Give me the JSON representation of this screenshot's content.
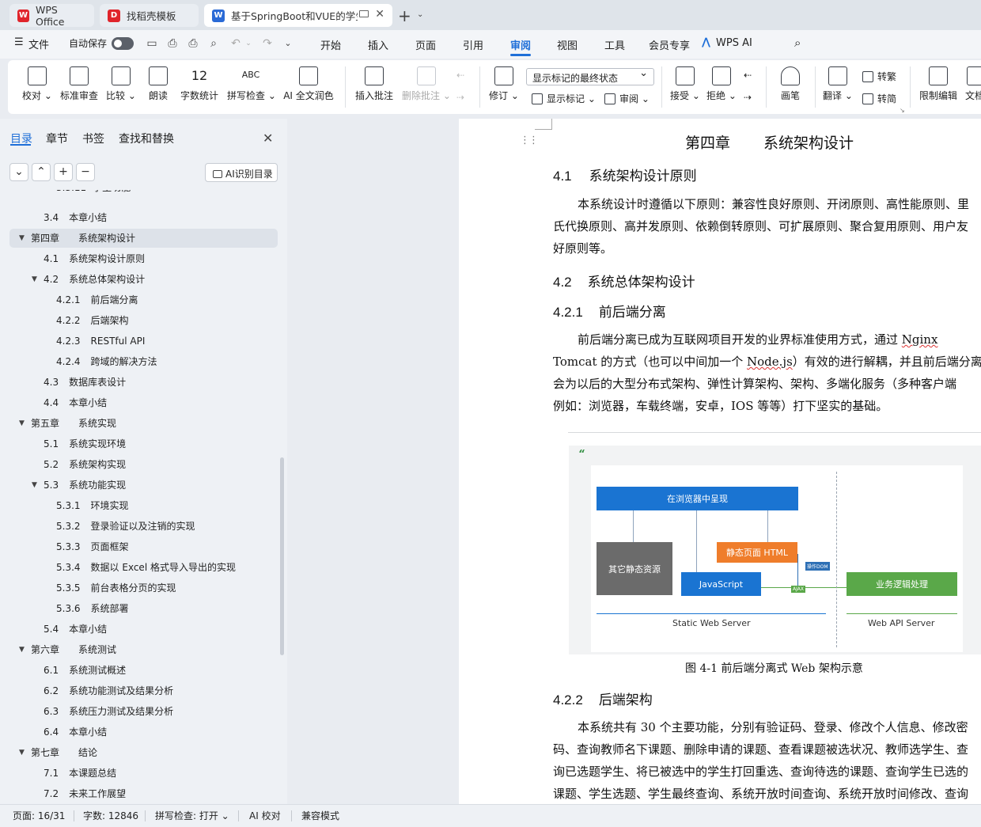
{
  "tabs": [
    {
      "label": "WPS Office",
      "icon": "wps-logo-icon",
      "color": "#e0242b"
    },
    {
      "label": "找稻壳模板",
      "icon": "docer-logo-icon",
      "color": "#e0242b"
    },
    {
      "label": "基于SpringBoot和VUE的学生",
      "icon": "word-doc-icon",
      "color": "#2a6ad6"
    }
  ],
  "menu": {
    "file": "文件",
    "autosave": "自动保存",
    "items": [
      "开始",
      "插入",
      "页面",
      "引用",
      "审阅",
      "视图",
      "工具",
      "会员专享"
    ],
    "active": "审阅",
    "wps_ai": "WPS AI"
  },
  "ribbon": {
    "proofread": "校对",
    "standard_review": "标准审查",
    "compare": "比较",
    "read_aloud": "朗读",
    "word_count": "字数统计",
    "spell_check": "拼写检查",
    "ai_polish": "AI 全文润色",
    "insert_comment": "插入批注",
    "delete_comment": "删除批注",
    "revise": "修订",
    "markup_select": "显示标记的最终状态",
    "show_markup": "显示标记",
    "review": "审阅",
    "accept": "接受",
    "reject": "拒绝",
    "brush": "画笔",
    "translate": "翻译",
    "to_trad": "转繁",
    "to_simp": "转简",
    "restrict_edit": "限制编辑",
    "doc_cut": "文档",
    "abc": "ABC",
    "count_icon_text": "12"
  },
  "sidebar": {
    "tabs": [
      "目录",
      "章节",
      "书签",
      "查找和替换"
    ],
    "ai_toc": "AI识别目录",
    "toc": [
      {
        "num": "3.3.11",
        "title": "学生功能",
        "level": 3,
        "partial": true
      },
      {
        "num": "3.4",
        "title": "本章小结",
        "level": 2
      },
      {
        "num": "第四章",
        "title": "系统架构设计",
        "level": 1,
        "expanded": true,
        "selected": true
      },
      {
        "num": "4.1",
        "title": "系统架构设计原则",
        "level": 2
      },
      {
        "num": "4.2",
        "title": "系统总体架构设计",
        "level": 2,
        "expanded": true
      },
      {
        "num": "4.2.1",
        "title": "前后端分离",
        "level": 3
      },
      {
        "num": "4.2.2",
        "title": "后端架构",
        "level": 3
      },
      {
        "num": "4.2.3",
        "title": "RESTful API",
        "level": 3
      },
      {
        "num": "4.2.4",
        "title": "跨域的解决方法",
        "level": 3
      },
      {
        "num": "4.3",
        "title": "数据库表设计",
        "level": 2
      },
      {
        "num": "4.4",
        "title": "本章小结",
        "level": 2
      },
      {
        "num": "第五章",
        "title": "系统实现",
        "level": 1,
        "expanded": true
      },
      {
        "num": "5.1",
        "title": "系统实现环境",
        "level": 2
      },
      {
        "num": "5.2",
        "title": "系统架构实现",
        "level": 2
      },
      {
        "num": "5.3",
        "title": "系统功能实现",
        "level": 2,
        "expanded": true
      },
      {
        "num": "5.3.1",
        "title": "环境实现",
        "level": 3
      },
      {
        "num": "5.3.2",
        "title": "登录验证以及注销的实现",
        "level": 3
      },
      {
        "num": "5.3.3",
        "title": "页面框架",
        "level": 3
      },
      {
        "num": "5.3.4",
        "title": "数据以 Excel 格式导入导出的实现",
        "level": 3
      },
      {
        "num": "5.3.5",
        "title": "前台表格分页的实现",
        "level": 3
      },
      {
        "num": "5.3.6",
        "title": "系统部署",
        "level": 3
      },
      {
        "num": "5.4",
        "title": "本章小结",
        "level": 2
      },
      {
        "num": "第六章",
        "title": "系统测试",
        "level": 1,
        "expanded": true
      },
      {
        "num": "6.1",
        "title": "系统测试概述",
        "level": 2
      },
      {
        "num": "6.2",
        "title": "系统功能测试及结果分析",
        "level": 2
      },
      {
        "num": "6.3",
        "title": "系统压力测试及结果分析",
        "level": 2
      },
      {
        "num": "6.4",
        "title": "本章小结",
        "level": 2
      },
      {
        "num": "第七章",
        "title": "结论",
        "level": 1,
        "expanded": true
      },
      {
        "num": "7.1",
        "title": "本课题总结",
        "level": 2
      },
      {
        "num": "7.2",
        "title": "未来工作展望",
        "level": 2
      }
    ]
  },
  "document": {
    "chapter_num": "第四章",
    "chapter_title": "系统架构设计",
    "s41_num": "4.1",
    "s41_title": "系统架构设计原则",
    "p41": [
      "本系统设计时遵循以下原则：兼容性良好原则、开闭原则、高性能原则、里",
      "氏代换原则、高并发原则、依赖倒转原则、可扩展原则、聚合复用原则、用户友",
      "好原则等。"
    ],
    "s42_num": "4.2",
    "s42_title": "系统总体架构设计",
    "s421_num": "4.2.1",
    "s421_title": "前后端分离",
    "p421": {
      "l1a": "前后端分离已成为互联网项目开发的业界标准使用方式，通过 ",
      "l1b": "Nginx",
      "l2a": "Tomcat 的方式（也可以中间加一个 ",
      "l2b": "Node.js",
      "l2c": "）有效的进行解耦，并且前后端分离",
      "l3": "会为以后的大型分布式架构、弹性计算架构、架构、多端化服务（多种客户端",
      "l4": "例如：浏览器，车载终端，安卓，IOS 等等）打下坚实的基础。"
    },
    "figure": {
      "box_browser": "在浏览器中呈现",
      "box_static": "其它静态资源",
      "box_html": "静态页面 HTML",
      "box_js": "JavaScript",
      "box_biz": "业务逻辑处理",
      "tag_dom": "操作DOM",
      "tag_ajax": "AJAX",
      "label_static_server": "Static Web Server",
      "label_api_server": "Web API Server",
      "colors": {
        "blue": "#1a74d2",
        "gray": "#6b6b6b",
        "orange": "#ef7d2b",
        "green": "#5aa849"
      }
    },
    "caption": "图 4-1  前后端分离式 Web 架构示意",
    "s422_num": "4.2.2",
    "s422_title": "后端架构",
    "p422": [
      "本系统共有 30 个主要功能，分别有验证码、登录、修改个人信息、修改密",
      "码、查询教师名下课题、删除申请的课题、查看课题被选状况、教师选学生、查",
      "询已选题学生、将已被选中的学生打回重选、查询待选的课题、查询学生已选的",
      "课题、学生选题、学生最终查询、系统开放时间查询、系统开放时间修改、查询"
    ]
  },
  "status": {
    "page": "页面: 16/31",
    "words": "字数: 12846",
    "spell": "拼写检查: 打开",
    "ai_check": "AI 校对",
    "compat": "兼容模式"
  }
}
